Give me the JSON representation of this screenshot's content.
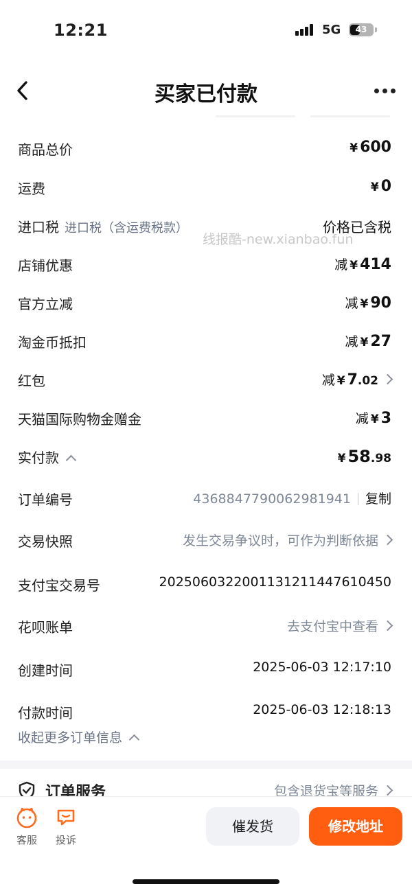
{
  "status_bar": {
    "time": "12:21",
    "network": "5G",
    "battery": "43",
    "battery_level_pct": 43
  },
  "header": {
    "title": "买家已付款"
  },
  "summary": [
    {
      "label": "商品总价",
      "currency": "¥",
      "amount": "600"
    },
    {
      "label": "运费",
      "currency": "¥",
      "amount": "0"
    },
    {
      "label": "进口税",
      "sublabel": "进口税（含运费税款）",
      "value": "价格已含税"
    },
    {
      "label": "店铺优惠",
      "prefix": "减",
      "currency": "¥",
      "amount": "414"
    },
    {
      "label": "官方立减",
      "prefix": "减",
      "currency": "¥",
      "amount": "90"
    },
    {
      "label": "淘金币抵扣",
      "prefix": "减",
      "currency": "¥",
      "amount": "27"
    },
    {
      "label": "红包",
      "prefix": "减",
      "currency": "¥",
      "amount": "7",
      "decimal": ".02"
    },
    {
      "label": "天猫国际购物金赠金",
      "prefix": "减",
      "currency": "¥",
      "amount": "3"
    },
    {
      "label": "实付款",
      "currency": "¥",
      "amount": "58",
      "decimal": ".98"
    }
  ],
  "watermark": "线报酷-new.xianbao.fun",
  "order_info": {
    "order_no_label": "订单编号",
    "order_no": "4368847790062981941",
    "copy_label": "复制",
    "snapshot_label": "交易快照",
    "snapshot_value": "发生交易争议时，可作为判断依据",
    "alipay_label": "支付宝交易号",
    "alipay_no": "2025060322001131211447610450",
    "huabei_label": "花呗账单",
    "huabei_value": "去支付宝中查看",
    "created_label": "创建时间",
    "created_time": "2025-06-03 12:17:10",
    "paid_label": "付款时间",
    "paid_time": "2025-06-03 12:18:13",
    "collapse_label": "收起更多订单信息"
  },
  "service": {
    "title": "订单服务",
    "right": "包含退货宝等服务"
  },
  "bottom": {
    "service_label": "客服",
    "complaint_label": "投诉",
    "remind_label": "催发货",
    "change_address_label": "修改地址"
  },
  "colors": {
    "accent": "#ff5e10",
    "discount": "#f0591a",
    "secondary_text": "#7f8897"
  }
}
